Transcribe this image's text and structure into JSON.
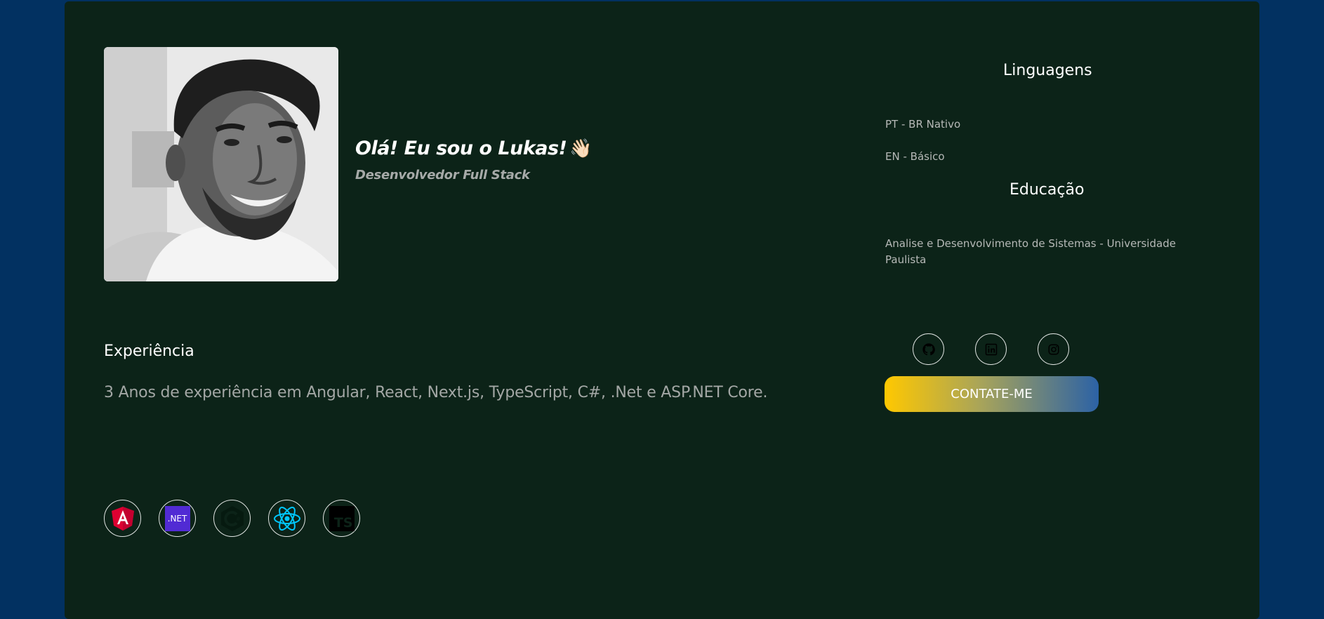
{
  "hero": {
    "greeting": "Olá! Eu sou o Lukas!",
    "wave_emoji": "👋🏻",
    "role": "Desenvolvedor Full Stack"
  },
  "languages": {
    "title": "Linguagens",
    "items": [
      "PT - BR Nativo",
      "EN - Básico"
    ]
  },
  "education": {
    "title": "Educação",
    "items": [
      "Analise e Desenvolvimento de Sistemas - Universidade Paulista"
    ]
  },
  "experience": {
    "title": "Experiência",
    "text": "3 Anos de experiência em Angular, React, Next.js, TypeScript, C#, .Net e ASP.NET Core."
  },
  "social": [
    {
      "icon": "github-icon"
    },
    {
      "icon": "linkedin-icon"
    },
    {
      "icon": "instagram-icon"
    }
  ],
  "contact_button": {
    "label": "CONTATE-ME"
  },
  "tech_stack": [
    {
      "icon": "angular-icon"
    },
    {
      "icon": "dotnet-icon",
      "label": ".NET"
    },
    {
      "icon": "csharp-icon"
    },
    {
      "icon": "react-icon"
    },
    {
      "icon": "typescript-icon",
      "label": "TS"
    }
  ],
  "colors": {
    "page_background": "#023161",
    "card_background": "#0c2318",
    "gradient_start": "#ffc800",
    "gradient_end": "#2c62a5"
  }
}
